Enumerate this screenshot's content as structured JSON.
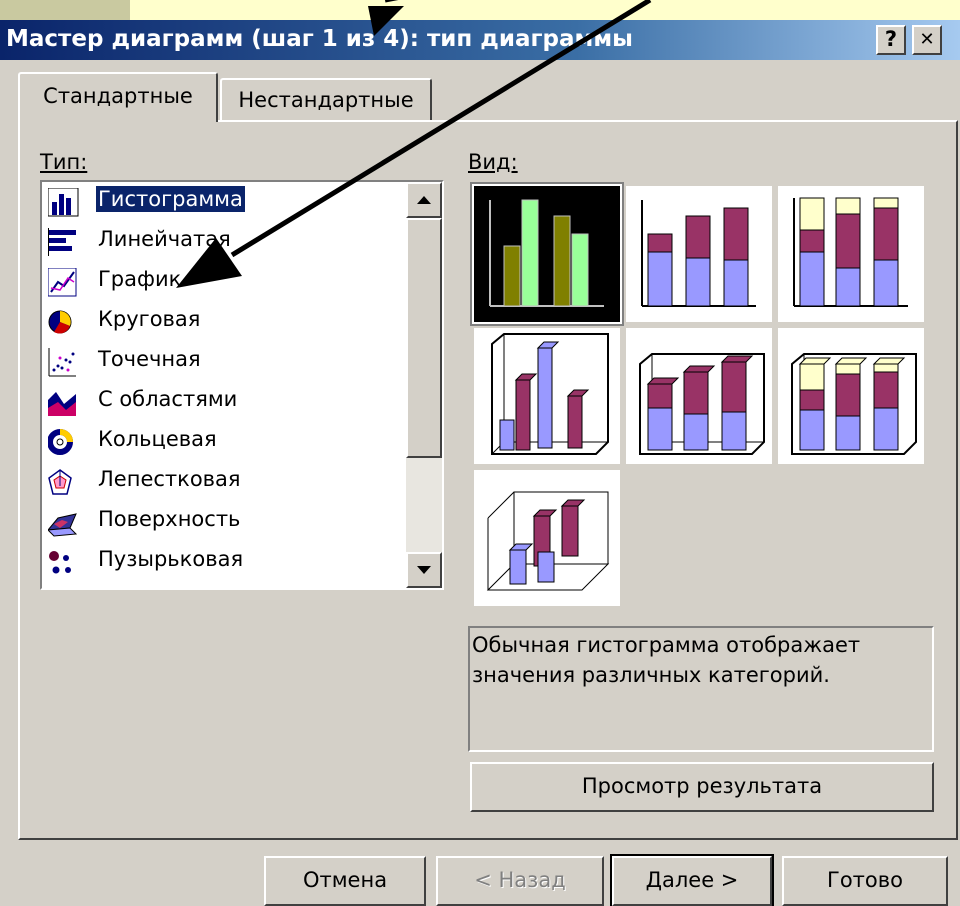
{
  "window": {
    "title": "Мастер диаграмм (шаг 1 из 4): тип диаграммы",
    "help_label": "?",
    "close_label": "✕"
  },
  "tabs": [
    {
      "label": "Стандартные",
      "active": true
    },
    {
      "label": "Нестандартные",
      "active": false
    }
  ],
  "type_section": {
    "label": "Тип:",
    "items": [
      {
        "label": "Гистограмма",
        "icon": "column-chart-icon",
        "selected": true
      },
      {
        "label": "Линейчатая",
        "icon": "bar-chart-icon"
      },
      {
        "label": "График",
        "icon": "line-chart-icon"
      },
      {
        "label": "Круговая",
        "icon": "pie-chart-icon"
      },
      {
        "label": "Точечная",
        "icon": "scatter-chart-icon"
      },
      {
        "label": "С областями",
        "icon": "area-chart-icon"
      },
      {
        "label": "Кольцевая",
        "icon": "doughnut-chart-icon"
      },
      {
        "label": "Лепестковая",
        "icon": "radar-chart-icon"
      },
      {
        "label": "Поверхность",
        "icon": "surface-chart-icon"
      },
      {
        "label": "Пузырьковая",
        "icon": "bubble-chart-icon"
      }
    ]
  },
  "view_section": {
    "label": "Вид:",
    "subtypes": [
      {
        "name": "clustered-column",
        "selected": true
      },
      {
        "name": "stacked-column"
      },
      {
        "name": "100-stacked-column"
      },
      {
        "name": "3d-clustered-column"
      },
      {
        "name": "3d-stacked-column"
      },
      {
        "name": "3d-100-stacked-column"
      },
      {
        "name": "3d-column"
      }
    ]
  },
  "description": "Обычная гистограмма отображает значения различных категорий.",
  "preview_button": "Просмотр результата",
  "buttons": {
    "cancel": "Отмена",
    "back": "< Назад",
    "next": "Далее >",
    "finish": "Готово"
  },
  "colors": {
    "selection": "#0a246a",
    "series_blue": "#9999ff",
    "series_maroon": "#993366",
    "series_cream": "#ffffcc",
    "series_olive": "#808000",
    "series_green": "#99ff99"
  }
}
